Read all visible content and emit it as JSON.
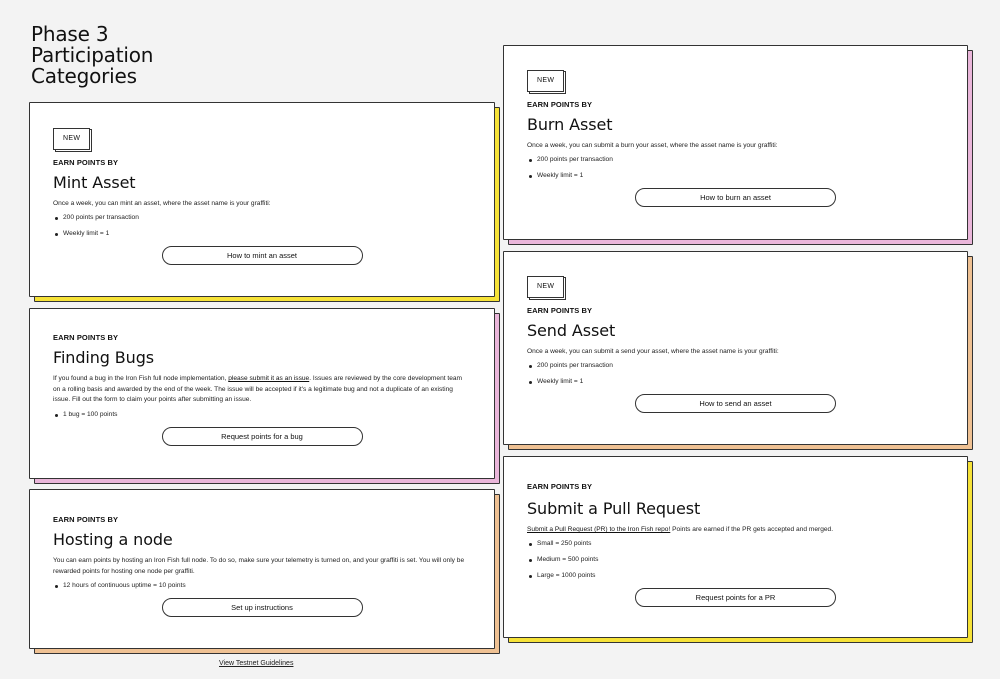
{
  "page": {
    "title_lines": [
      "Phase 3",
      "Participation",
      "Categories"
    ],
    "footer_link": "View Testnet Guidelines"
  },
  "colors": {
    "yellow": "#f6e238",
    "pink": "#eab6da",
    "orange": "#efc193",
    "border": "#333333"
  },
  "cards": {
    "mint": {
      "badge": "NEW",
      "eyebrow": "EARN POINTS BY",
      "title": "Mint Asset",
      "description": "Once a week, you can mint an asset, where the asset name is your graffiti:",
      "bullets": [
        "200 points per transaction",
        "Weekly limit = 1"
      ],
      "button": "How to mint an asset"
    },
    "bugs": {
      "eyebrow": "EARN POINTS BY",
      "title": "Finding Bugs",
      "desc_before": "If you found a bug in the Iron Fish full node implementation, ",
      "desc_link": "please submit it as an issue",
      "desc_after": ". Issues are reviewed by the core development team on a rolling basis and awarded by the end of the week. The issue will be accepted if it's a legitimate bug and not a duplicate of an existing issue. Fill out the form to claim your points after submitting an issue.",
      "bullets": [
        "1 bug = 100 points"
      ],
      "button": "Request points for a bug"
    },
    "node": {
      "eyebrow": "EARN POINTS BY",
      "title": "Hosting a node",
      "description": "You can earn points by hosting an Iron Fish full node. To do so, make sure your telemetry is turned on, and your graffiti is set. You will only be rewarded points for hosting one node per graffiti.",
      "bullets": [
        "12 hours of continuous uptime = 10 points"
      ],
      "button": "Set up instructions"
    },
    "burn": {
      "badge": "NEW",
      "eyebrow": "EARN POINTS BY",
      "title": "Burn Asset",
      "description": "Once a week, you can submit a burn your asset, where the asset name is your graffiti:",
      "bullets": [
        "200 points per transaction",
        "Weekly limit = 1"
      ],
      "button": "How to burn an asset"
    },
    "send": {
      "badge": "NEW",
      "eyebrow": "EARN POINTS BY",
      "title": "Send Asset",
      "description": "Once a week, you can submit a send your asset, where the asset name is your graffiti:",
      "bullets": [
        "200 points per transaction",
        "Weekly limit = 1"
      ],
      "button": "How to send an asset"
    },
    "pr": {
      "eyebrow": "EARN POINTS BY",
      "title": "Submit a Pull Request",
      "desc_link": "Submit a Pull Request (PR) to the Iron Fish repo!",
      "desc_after": " Points are earned if the PR gets accepted and merged.",
      "bullets": [
        "Small = 250 points",
        "Medium = 500 points",
        "Large = 1000 points"
      ],
      "button": "Request points for a PR"
    }
  }
}
